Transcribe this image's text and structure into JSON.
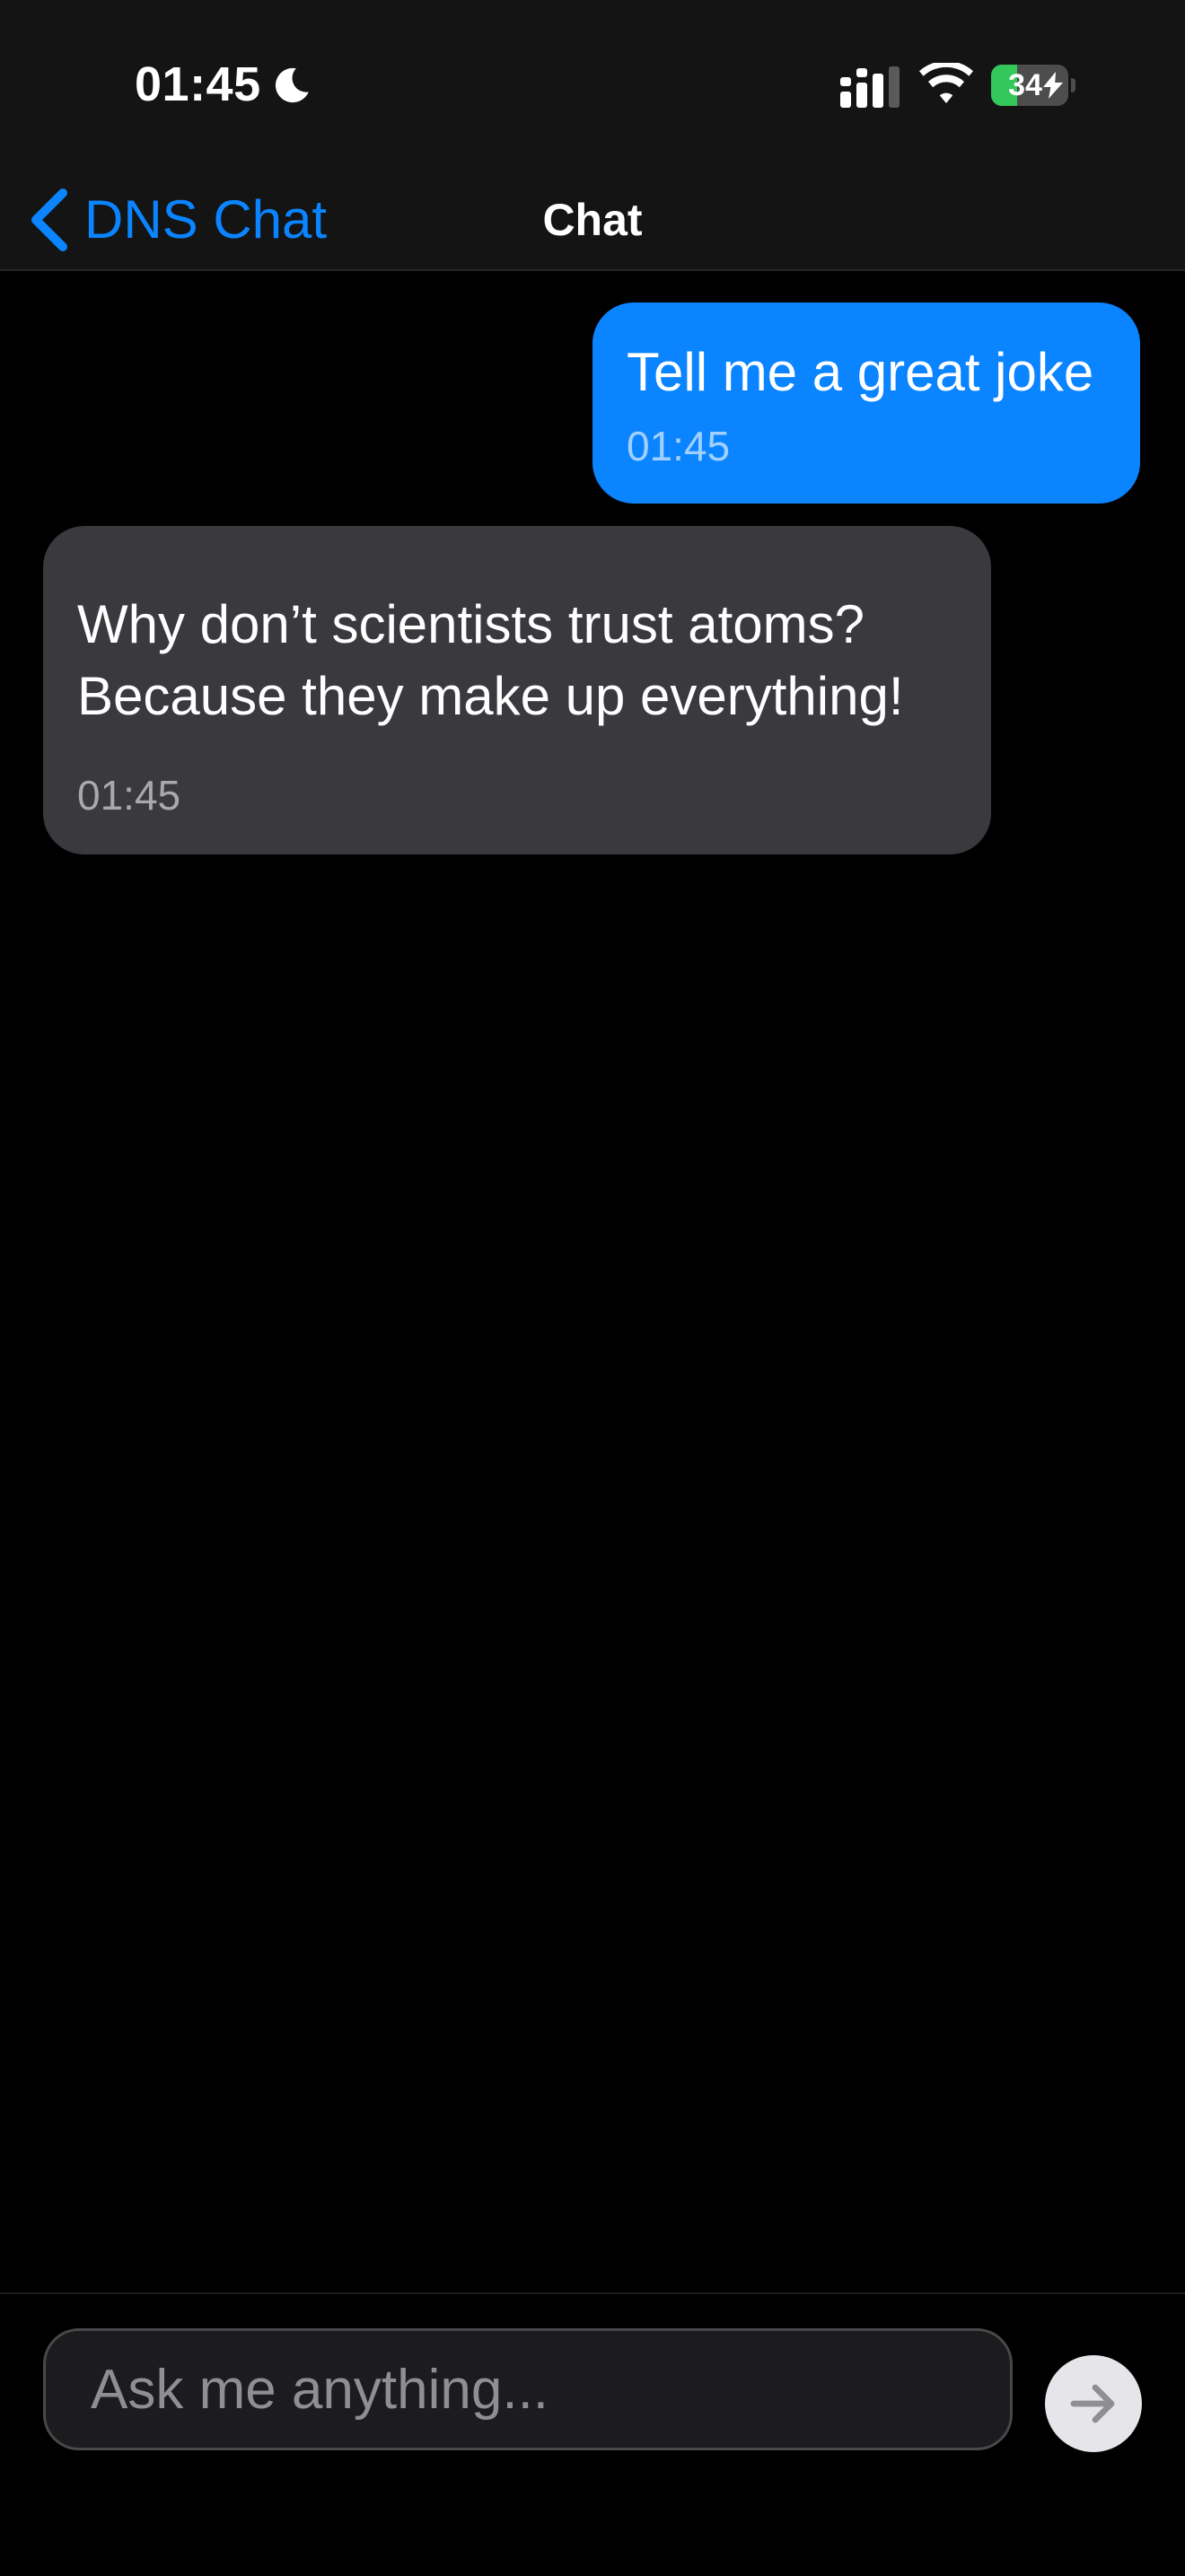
{
  "status_bar": {
    "time": "01:45",
    "battery_level": "34",
    "battery_fraction": 0.34,
    "icons": [
      "moon-icon",
      "signal-icon",
      "wifi-icon",
      "charging-icon"
    ]
  },
  "nav": {
    "back_label": "DNS Chat",
    "title": "Chat"
  },
  "messages": [
    {
      "role": "user",
      "text": "Tell me a great joke",
      "time": "01:45"
    },
    {
      "role": "assistant",
      "text": "Why don’t scientists trust atoms?\nBecause they make up everything!",
      "time": "01:45"
    }
  ],
  "composer": {
    "placeholder": "Ask me anything...",
    "value": "",
    "send_icon": "arrow-right-icon"
  },
  "colors": {
    "accent": "#0a84ff",
    "assistant_bubble": "#3a3a3e",
    "background": "#000000",
    "battery_green": "#34c759"
  }
}
